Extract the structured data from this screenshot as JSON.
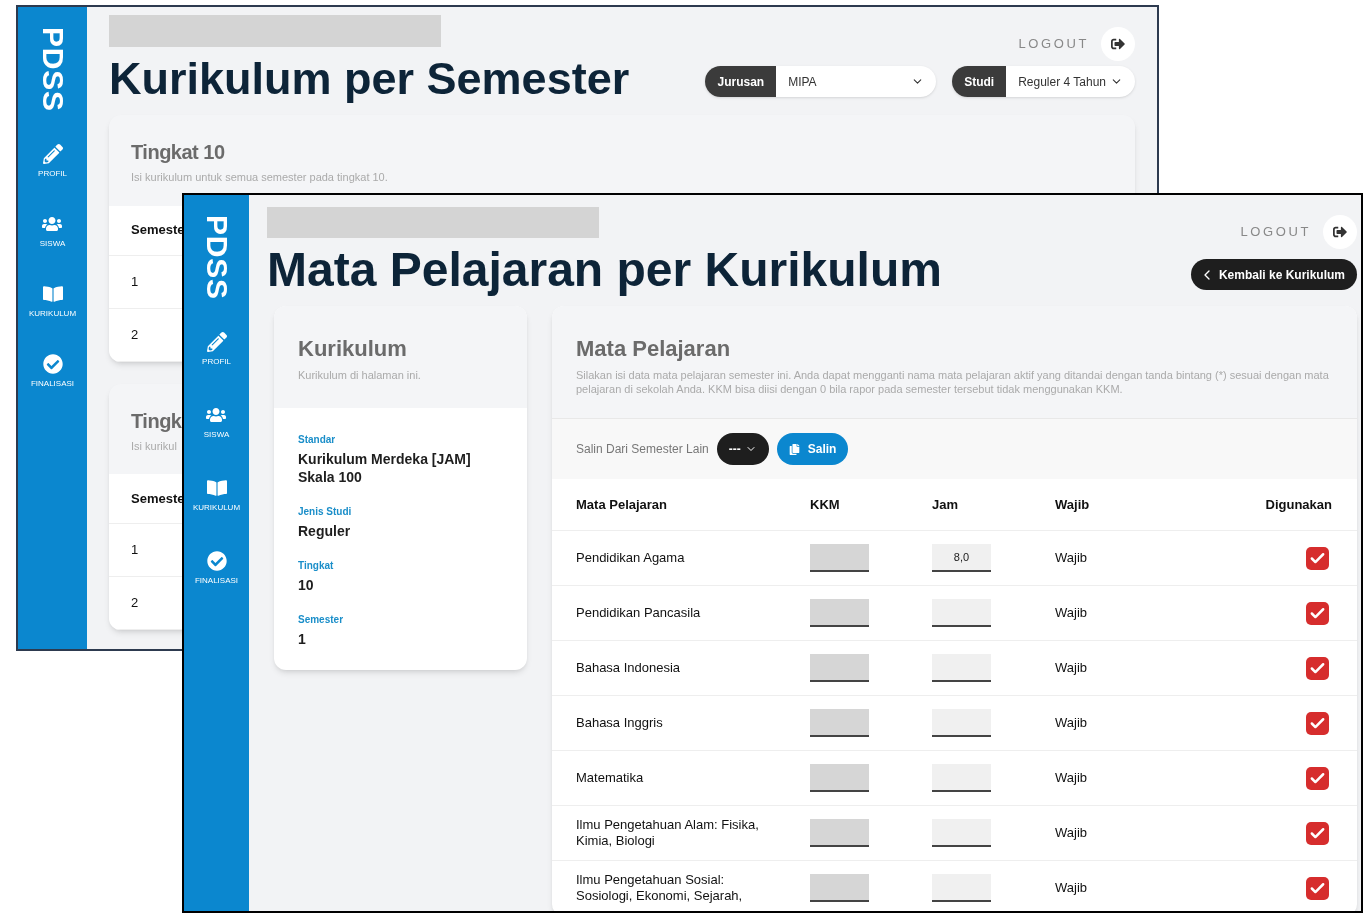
{
  "back_window": {
    "sidebar": {
      "logo": "PDSS",
      "items": [
        {
          "label": "PROFIL"
        },
        {
          "label": "SISWA"
        },
        {
          "label": "KURIKULUM"
        },
        {
          "label": "FINALISASI"
        }
      ]
    },
    "title": "Kurikulum per Semester",
    "logout": "LOGOUT",
    "filters": [
      {
        "label": "Jurusan",
        "value": "MIPA"
      },
      {
        "label": "Studi",
        "value": "Reguler 4 Tahun"
      }
    ],
    "cards": [
      {
        "title": "Tingkat 10",
        "subtitle": "Isi kurikulum untuk semua semester pada tingkat 10.",
        "table": {
          "columns": [
            "Semeste"
          ],
          "rows": [
            "1",
            "2"
          ]
        }
      },
      {
        "title": "Tingk",
        "subtitle": "Isi kurikul",
        "table": {
          "columns": [
            "Semeste"
          ],
          "rows": [
            "1",
            "2"
          ]
        }
      }
    ]
  },
  "front_window": {
    "sidebar": {
      "logo": "PDSS",
      "items": [
        {
          "label": "PROFIL"
        },
        {
          "label": "SISWA"
        },
        {
          "label": "KURIKULUM"
        },
        {
          "label": "FINALISASI"
        }
      ]
    },
    "title": "Mata Pelajaran per Kurikulum",
    "logout": "LOGOUT",
    "back_button": "Kembali ke Kurikulum",
    "info_card": {
      "title": "Kurikulum",
      "subtitle": "Kurikulum di halaman ini.",
      "fields": [
        {
          "label": "Standar",
          "value": "Kurikulum Merdeka [JAM] Skala 100"
        },
        {
          "label": "Jenis Studi",
          "value": "Reguler"
        },
        {
          "label": "Tingkat",
          "value": "10"
        },
        {
          "label": "Semester",
          "value": "1"
        }
      ]
    },
    "subjects_card": {
      "title": "Mata Pelajaran",
      "description": "Silakan isi data mata pelajaran semester ini. Anda dapat mengganti nama mata pelajaran aktif yang ditandai dengan tanda bintang (*) sesuai dengan mata pelajaran di sekolah Anda. KKM bisa diisi dengan 0 bila rapor pada semester tersebut tidak menggunakan KKM.",
      "copy_label": "Salin Dari Semester Lain",
      "copy_select": "---",
      "copy_button": "Salin",
      "table": {
        "columns": [
          "Mata Pelajaran",
          "KKM",
          "Jam",
          "Wajib",
          "Digunakan"
        ],
        "rows": [
          {
            "name": "Pendidikan Agama",
            "jam": "8,0",
            "wajib": "Wajib",
            "checked": true
          },
          {
            "name": "Pendidikan Pancasila",
            "wajib": "Wajib",
            "checked": true
          },
          {
            "name": "Bahasa Indonesia",
            "wajib": "Wajib",
            "checked": true
          },
          {
            "name": "Bahasa Inggris",
            "wajib": "Wajib",
            "checked": true
          },
          {
            "name": "Matematika",
            "wajib": "Wajib",
            "checked": true
          },
          {
            "name": "Ilmu Pengetahuan Alam: Fisika, Kimia, Biologi",
            "wajib": "Wajib",
            "checked": true
          },
          {
            "name": "Ilmu Pengetahuan Sosial: Sosiologi, Ekonomi, Sejarah,",
            "wajib": "Wajib",
            "checked": true
          }
        ]
      }
    }
  }
}
